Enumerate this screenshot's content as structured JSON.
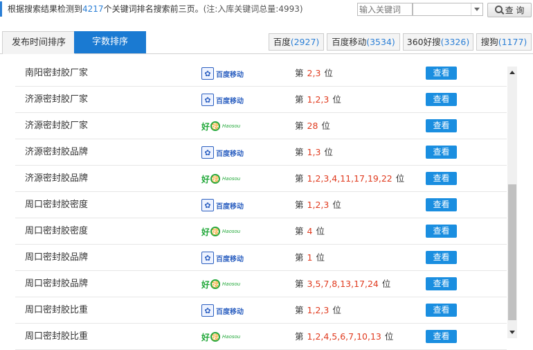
{
  "summary": {
    "prefix": "根据搜索结果检测到",
    "count": "4217",
    "suffix": "个关键词排名搜索前三页。",
    "note": "(注:入库关键词总量:4993)"
  },
  "search": {
    "placeholder": "输入关键词",
    "select_value": "",
    "button_label": "查 询"
  },
  "tabs": [
    {
      "label": "发布时间排序",
      "active": false
    },
    {
      "label": "字数排序",
      "active": true
    }
  ],
  "engines": [
    {
      "name": "百度",
      "count": "(2927)"
    },
    {
      "name": "百度移动",
      "count": "(3534)"
    },
    {
      "name": "360好搜",
      "count": "(3326)"
    },
    {
      "name": "搜狗",
      "count": "(1177)"
    }
  ],
  "rank_prefix": "第",
  "rank_suffix": "位",
  "view_label": "查看",
  "logos": {
    "baidu_mobile": "百度移动",
    "haosou_main": "好",
    "haosou_q": "搜",
    "haosou_small": "Haosou"
  },
  "rows": [
    {
      "keyword": "南阳密封胶厂家",
      "engine": "baidu-mobile",
      "positions": "2,3"
    },
    {
      "keyword": "济源密封胶厂家",
      "engine": "baidu-mobile",
      "positions": "1,2,3"
    },
    {
      "keyword": "济源密封胶厂家",
      "engine": "haosou",
      "positions": "28"
    },
    {
      "keyword": "济源密封胶品牌",
      "engine": "baidu-mobile",
      "positions": "1,3"
    },
    {
      "keyword": "济源密封胶品牌",
      "engine": "haosou",
      "positions": "1,2,3,4,11,17,19,22"
    },
    {
      "keyword": "周口密封胶密度",
      "engine": "baidu-mobile",
      "positions": "1,2,3"
    },
    {
      "keyword": "周口密封胶密度",
      "engine": "haosou",
      "positions": "4"
    },
    {
      "keyword": "周口密封胶品牌",
      "engine": "baidu-mobile",
      "positions": "1"
    },
    {
      "keyword": "周口密封胶品牌",
      "engine": "haosou",
      "positions": "3,5,7,8,13,17,24"
    },
    {
      "keyword": "周口密封胶比重",
      "engine": "baidu-mobile",
      "positions": "1,2,3"
    },
    {
      "keyword": "周口密封胶比重",
      "engine": "haosou",
      "positions": "1,2,4,5,6,7,10,13"
    }
  ],
  "colors": {
    "accent": "#1a7ad2",
    "button": "#1a8ee0",
    "rank": "#e03a1e",
    "count": "#2b7fd6"
  }
}
